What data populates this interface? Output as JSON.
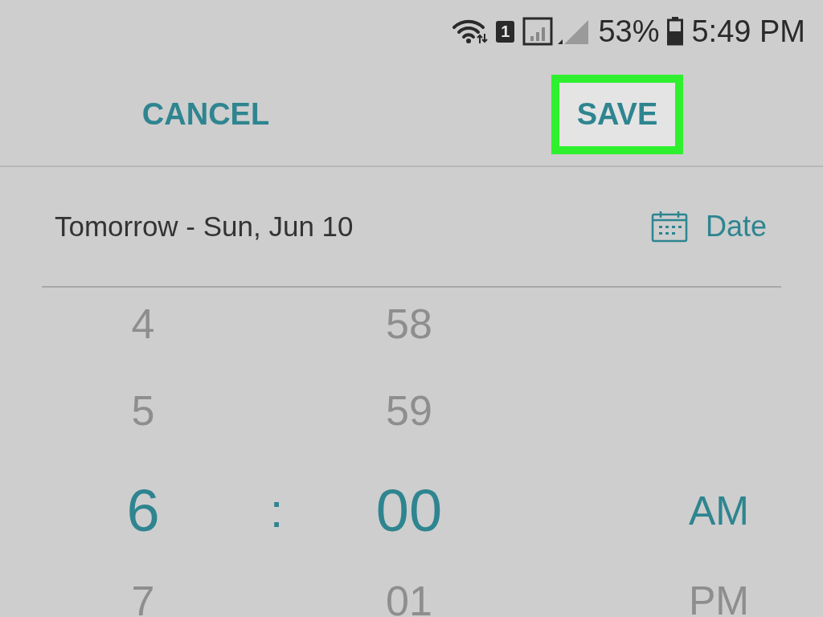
{
  "status_bar": {
    "sim_label": "1",
    "battery_text": "53%",
    "time": "5:49 PM"
  },
  "actions": [
    {
      "label": "CANCEL",
      "highlighted": false
    },
    {
      "label": "SAVE",
      "highlighted": true
    }
  ],
  "date_row": {
    "text": "Tomorrow - Sun, Jun 10",
    "button": "Date"
  },
  "picker": {
    "separator": ":",
    "hours": [
      {
        "value": "4",
        "selected": false
      },
      {
        "value": "5",
        "selected": false
      },
      {
        "value": "6",
        "selected": true
      },
      {
        "value": "7",
        "selected": false
      }
    ],
    "minutes": [
      {
        "value": "58",
        "selected": false
      },
      {
        "value": "59",
        "selected": false
      },
      {
        "value": "00",
        "selected": true
      },
      {
        "value": "01",
        "selected": false
      }
    ],
    "periods": [
      {
        "value": "AM",
        "selected": true
      },
      {
        "value": "PM",
        "selected": false
      }
    ]
  }
}
